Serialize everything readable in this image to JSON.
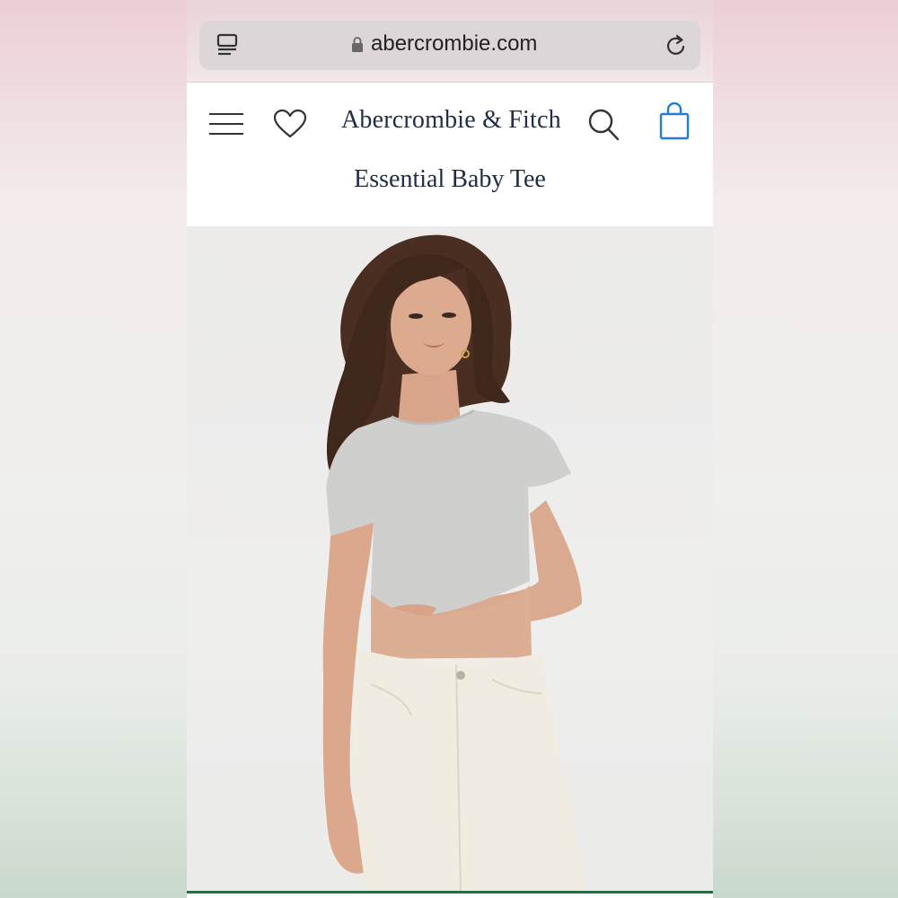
{
  "browser": {
    "url": "abercrombie.com",
    "icons": {
      "tabs": "tabs-icon",
      "lock": "lock-icon",
      "reload": "reload-icon"
    }
  },
  "header": {
    "brand": "Abercrombie & Fitch",
    "icons": {
      "menu": "hamburger-menu-icon",
      "wishlist": "heart-icon",
      "search": "search-icon",
      "bag": "shopping-bag-icon"
    }
  },
  "product": {
    "title": "Essential Baby Tee",
    "image_alt": "model wearing grey cropped tee and white jeans"
  },
  "colors": {
    "brand_text": "#1f2d45",
    "bag_accent": "#1f7fd6",
    "tee": "#cfcfcd",
    "jeans": "#f1ece2"
  }
}
